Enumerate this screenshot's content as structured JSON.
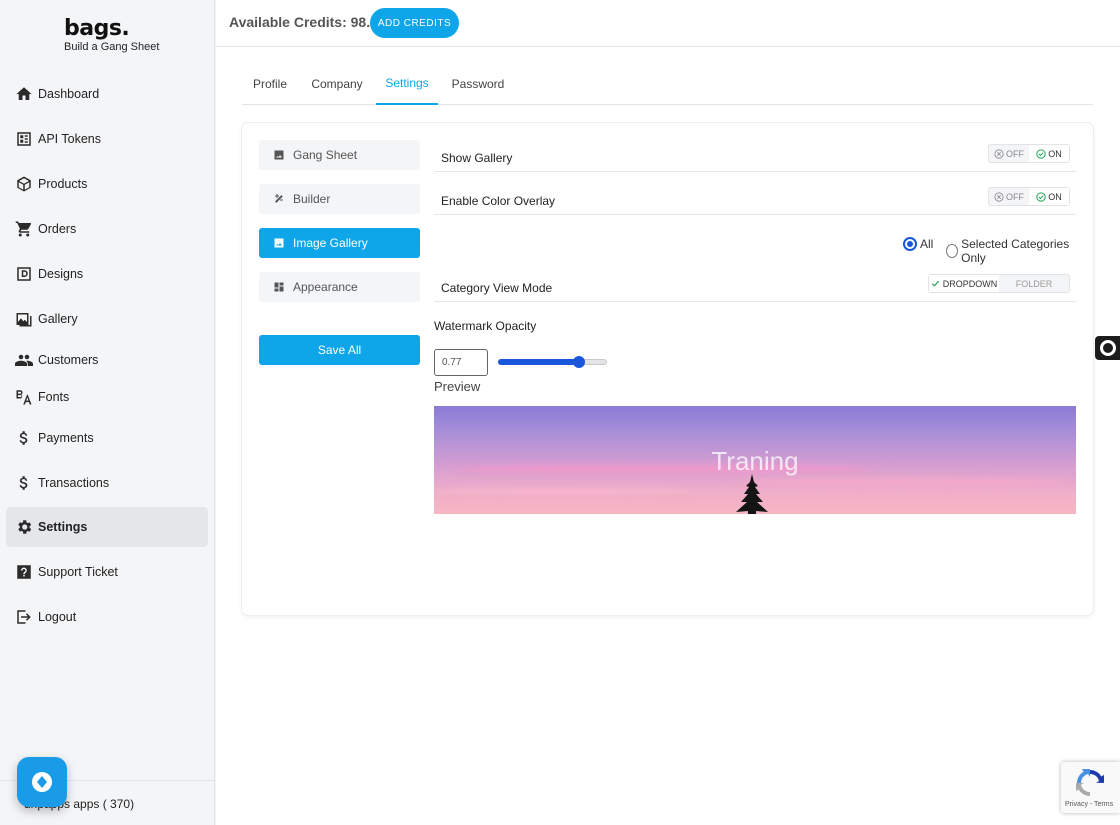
{
  "brand": {
    "name": "bags.",
    "tagline": "Build a Gang Sheet"
  },
  "sidebar": {
    "items": [
      {
        "label": "Dashboard",
        "icon": "home-icon"
      },
      {
        "label": "API Tokens",
        "icon": "api-icon"
      },
      {
        "label": "Products",
        "icon": "box-icon"
      },
      {
        "label": "Orders",
        "icon": "cart-icon"
      },
      {
        "label": "Designs",
        "icon": "designs-icon"
      },
      {
        "label": "Gallery",
        "icon": "gallery-icon"
      },
      {
        "label": "Customers",
        "icon": "users-icon"
      },
      {
        "label": "Fonts",
        "icon": "fonts-icon"
      },
      {
        "label": "Payments",
        "icon": "dollar-icon"
      },
      {
        "label": "Transactions",
        "icon": "dollar-icon"
      },
      {
        "label": "Settings",
        "icon": "gear-icon",
        "active": true
      },
      {
        "label": "Support Ticket",
        "icon": "help-icon"
      },
      {
        "label": "Logout",
        "icon": "logout-icon"
      }
    ],
    "footer": "dripapps apps ( 370)"
  },
  "topbar": {
    "credits": "Available Credits: 98.11",
    "add_credits": "ADD CREDITS"
  },
  "tabs": [
    {
      "label": "Profile"
    },
    {
      "label": "Company"
    },
    {
      "label": "Settings",
      "active": true
    },
    {
      "label": "Password"
    }
  ],
  "settings": {
    "subnav": [
      {
        "label": "Gang Sheet",
        "icon": "image-icon"
      },
      {
        "label": "Builder",
        "icon": "tools-icon"
      },
      {
        "label": "Image Gallery",
        "icon": "image-icon",
        "active": true
      },
      {
        "label": "Appearance",
        "icon": "dashboard-icon"
      }
    ],
    "save_all": "Save All",
    "show_gallery": {
      "label": "Show Gallery",
      "off": "OFF",
      "on": "ON",
      "value": "ON"
    },
    "color_overlay": {
      "label": "Enable Color Overlay",
      "off": "OFF",
      "on": "ON",
      "value": "ON"
    },
    "category_filter": {
      "options": [
        "All",
        "Selected Categories Only"
      ],
      "selected": "All"
    },
    "category_view_mode": {
      "label": "Category View Mode",
      "options": [
        "DROPDOWN",
        "FOLDER"
      ],
      "selected": "DROPDOWN"
    },
    "watermark": {
      "label": "Watermark Opacity",
      "value": "0.77",
      "slider_fraction": 0.77
    },
    "preview": {
      "label": "Preview",
      "watermark_text": "Traning"
    }
  },
  "recaptcha": {
    "terms": "Privacy - Terms"
  },
  "colors": {
    "accent": "#0ea5e9",
    "radio": "#1a56db",
    "toggle_on": "#22a559"
  }
}
